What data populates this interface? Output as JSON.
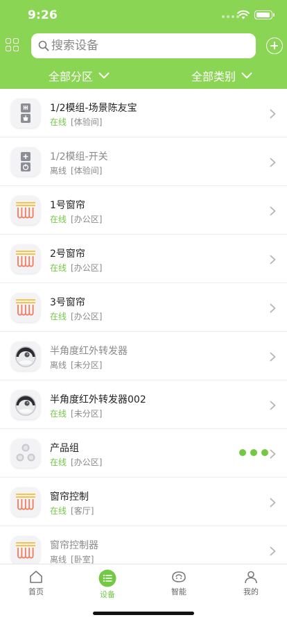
{
  "status_bar": {
    "time": "9:26"
  },
  "search": {
    "placeholder": "搜索设备"
  },
  "filters": {
    "zone_label": "全部分区",
    "type_label": "全部类别"
  },
  "devices": [
    {
      "name": "1/2模组-场景陈友宝",
      "status": "在线",
      "online": true,
      "room": "[体验间]",
      "icon": "scene-module-icon"
    },
    {
      "name": "1/2模组-开关",
      "status": "离线",
      "online": false,
      "room": "[体验间]",
      "icon": "switch-module-icon"
    },
    {
      "name": "1号窗帘",
      "status": "在线",
      "online": true,
      "room": "[办公区]",
      "icon": "curtain-icon"
    },
    {
      "name": "2号窗帘",
      "status": "在线",
      "online": true,
      "room": "[办公区]",
      "icon": "curtain-icon"
    },
    {
      "name": "3号窗帘",
      "status": "在线",
      "online": true,
      "room": "[办公区]",
      "icon": "curtain-icon"
    },
    {
      "name": "半角度红外转发器",
      "status": "离线",
      "online": false,
      "room": "[未分区]",
      "icon": "ir-blaster-icon"
    },
    {
      "name": "半角度红外转发器002",
      "status": "在线",
      "online": true,
      "room": "[未分区]",
      "icon": "ir-blaster-icon"
    },
    {
      "name": "产品组",
      "status": "在线",
      "online": true,
      "room": "[办公区]",
      "icon": "product-group-icon"
    },
    {
      "name": "窗帘控制",
      "status": "在线",
      "online": true,
      "room": "[客厅]",
      "icon": "curtain-icon"
    },
    {
      "name": "窗帘控制器",
      "status": "离线",
      "online": false,
      "room": "[卧室]",
      "icon": "curtain-icon"
    }
  ],
  "tabs": [
    {
      "label": "首页",
      "icon": "home-icon",
      "active": false
    },
    {
      "label": "设备",
      "icon": "device-list-icon",
      "active": true
    },
    {
      "label": "智能",
      "icon": "smart-icon",
      "active": false
    },
    {
      "label": "我的",
      "icon": "profile-icon",
      "active": false
    }
  ],
  "colors": {
    "header_green": "#8bd554",
    "online_green": "#74c944",
    "offline_gray": "#8a8a8a",
    "curtain_orange": "#f07a5a"
  }
}
